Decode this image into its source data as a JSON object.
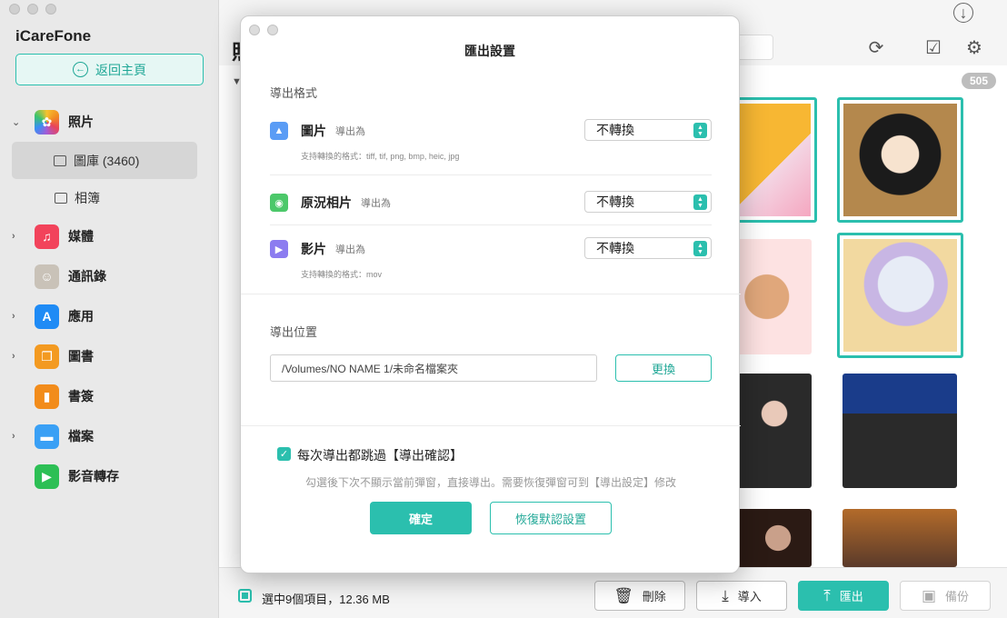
{
  "app": {
    "name": "iCareFone"
  },
  "sidebar": {
    "home_label": "返回主頁",
    "items": [
      {
        "label": "照片",
        "icon": "photos-icon",
        "color": "#ff8a3a"
      },
      {
        "label": "媒體",
        "icon": "music-icon",
        "color": "#f2435b"
      },
      {
        "label": "通訊錄",
        "icon": "contacts-icon",
        "color": "#b8b8b8"
      },
      {
        "label": "應用",
        "icon": "appstore-icon",
        "color": "#1f8bf5"
      },
      {
        "label": "圖書",
        "icon": "books-icon",
        "color": "#f39a21"
      },
      {
        "label": "書簽",
        "icon": "bookmarks-icon",
        "color": "#f28c1b"
      },
      {
        "label": "檔案",
        "icon": "files-icon",
        "color": "#3aa0f5"
      },
      {
        "label": "影音轉存",
        "icon": "video-transfer-icon",
        "color": "#2dbf55"
      }
    ],
    "sub_items": [
      {
        "label": "圖庫 (3460)"
      },
      {
        "label": "相簿"
      }
    ]
  },
  "main": {
    "title_partial": "照",
    "count_badge": "505"
  },
  "bottom": {
    "selection_text": "選中9個項目，12.36 MB",
    "buttons": {
      "delete": "刪除",
      "import": "導入",
      "export": "匯出",
      "backup": "備份"
    }
  },
  "dialog": {
    "title": "匯出設置",
    "format_section": "導出格式",
    "rows": [
      {
        "name": "圖片",
        "sub": "導出為",
        "value": "不轉換",
        "support": "支持轉換的格式：tiff, tif, png, bmp, heic, jpg"
      },
      {
        "name": "原況相片",
        "sub": "導出為",
        "value": "不轉換"
      },
      {
        "name": "影片",
        "sub": "導出為",
        "value": "不轉換",
        "support": "支持轉換的格式：mov"
      }
    ],
    "location_section": "導出位置",
    "path": "/Volumes/NO NAME 1/未命名檔案夾",
    "change_label": "更換",
    "skip_label": "每次導出都跳過【導出確認】",
    "skip_hint": "勾選後下次不顯示當前彈窗，直接導出。需要恢復彈窗可到【導出設定】修改",
    "ok_label": "確定",
    "reset_label": "恢復默認設置"
  },
  "colors": {
    "accent": "#2bbfae"
  }
}
